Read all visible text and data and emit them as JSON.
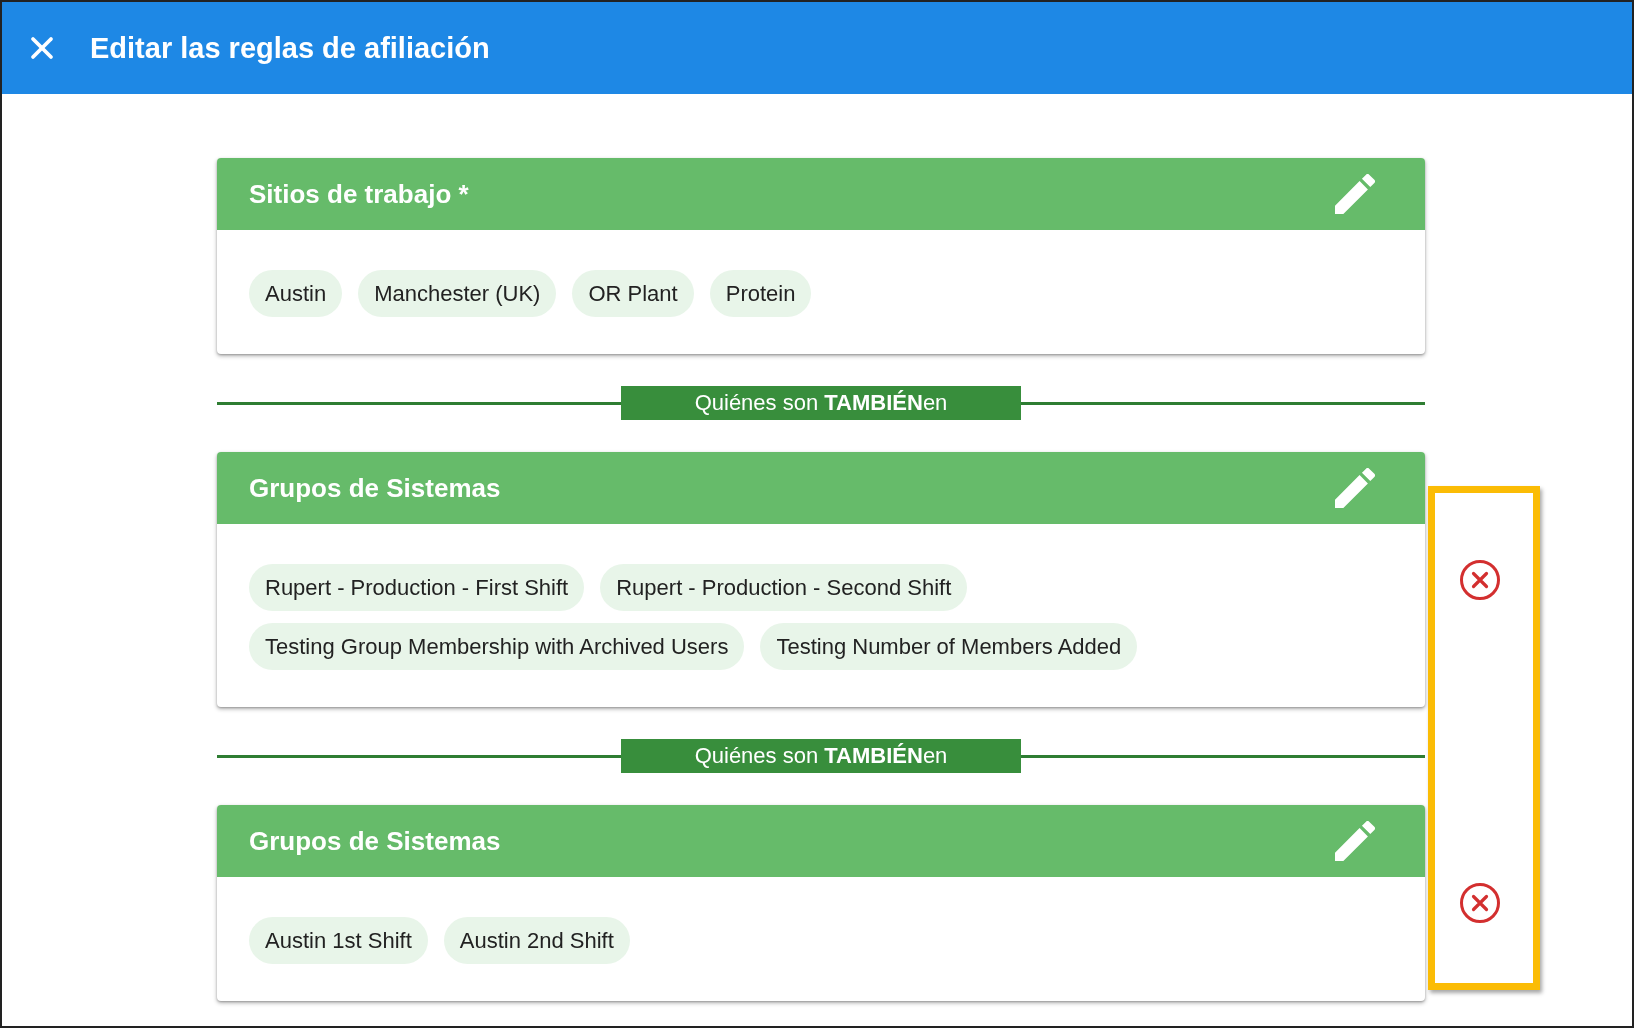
{
  "header": {
    "title": "Editar las reglas de afiliación"
  },
  "rule_blocks": [
    {
      "title": "Sitios de trabajo *",
      "removable": false,
      "chips": [
        "Austin",
        "Manchester (UK)",
        "OR Plant",
        "Protein"
      ]
    },
    {
      "connector": "Quiénes son **TAMBIÉN**en",
      "title": "Grupos de Sistemas",
      "removable": true,
      "chips": [
        "Rupert - Production - First Shift",
        "Rupert - Production - Second Shift",
        "Testing Group Membership with Archived Users",
        "Testing Number of Members Added"
      ]
    },
    {
      "connector": "Quiénes son **TAMBIÉN**en",
      "title": "Grupos de Sistemas",
      "removable": true,
      "chips": [
        "Austin 1st Shift",
        "Austin 2nd Shift"
      ]
    }
  ]
}
